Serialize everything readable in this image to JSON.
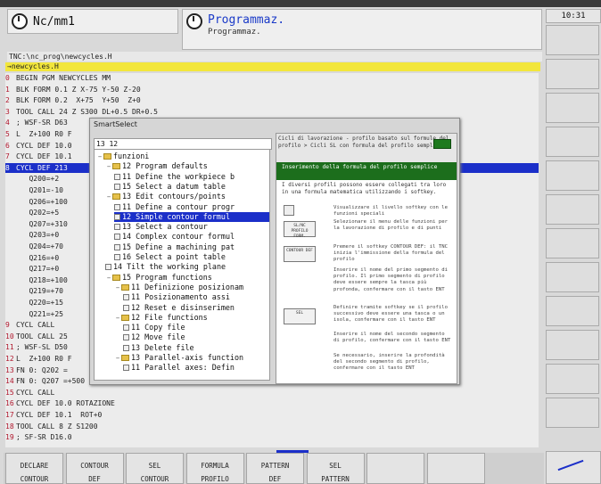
{
  "header": {
    "mode_left": "Nc/mm1",
    "mode_right": "Programmaz.",
    "mode_right_sub": "Programmaz.",
    "clock": "10:31"
  },
  "path": "TNC:\\nc_prog\\newcycles.H",
  "file": "→newcycles.H",
  "program_lines": [
    {
      "n": "0",
      "t": "BEGIN PGM NEWCYCLES MM"
    },
    {
      "n": "1",
      "t": "BLK FORM 0.1 Z X-75 Y-50 Z-20"
    },
    {
      "n": "2",
      "t": "BLK FORM 0.2  X+75  Y+50  Z+0"
    },
    {
      "n": "3",
      "t": "TOOL CALL 24 Z S300 DL+0.5 DR+0.5"
    },
    {
      "n": "4",
      "t": "; WSF-SR D63"
    },
    {
      "n": "5",
      "t": "L  Z+100 R0 F"
    },
    {
      "n": "6",
      "t": "CYCL DEF 10.0"
    },
    {
      "n": "7",
      "t": "CYCL DEF 10.1"
    },
    {
      "n": "8",
      "t": "CYCL DEF 213"
    },
    {
      "n": "",
      "t": "   Q200=+2"
    },
    {
      "n": "",
      "t": "   Q201=-10"
    },
    {
      "n": "",
      "t": "   Q206=+100"
    },
    {
      "n": "",
      "t": "   Q202=+5"
    },
    {
      "n": "",
      "t": "   Q207=+310"
    },
    {
      "n": "",
      "t": "   Q203=+0"
    },
    {
      "n": "",
      "t": "   Q204=+70"
    },
    {
      "n": "",
      "t": "   Q216=+0"
    },
    {
      "n": "",
      "t": "   Q217=+0"
    },
    {
      "n": "",
      "t": "   Q218=+100"
    },
    {
      "n": "",
      "t": "   Q219=+70"
    },
    {
      "n": "",
      "t": "   Q220=+15"
    },
    {
      "n": "",
      "t": "   Q221=+25"
    },
    {
      "n": "9",
      "t": "CYCL CALL"
    },
    {
      "n": "10",
      "t": "TOOL CALL 25"
    },
    {
      "n": "11",
      "t": "; WSF-SL D50"
    },
    {
      "n": "12",
      "t": "L  Z+100 R0 F"
    },
    {
      "n": "13",
      "t": "FN 0: Q202 ="
    },
    {
      "n": "14",
      "t": "FN 0: Q207 =+500"
    },
    {
      "n": "15",
      "t": "CYCL CALL"
    },
    {
      "n": "16",
      "t": "CYCL DEF 10.0 ROTAZIONE"
    },
    {
      "n": "17",
      "t": "CYCL DEF 10.1  ROT+0"
    },
    {
      "n": "18",
      "t": "TOOL CALL 8 Z S1200"
    },
    {
      "n": "19",
      "t": "; SF-SR D16.0"
    }
  ],
  "dialog": {
    "title": "SmartSelect",
    "search": "13 12",
    "tree": [
      {
        "d": 0,
        "k": "folder",
        "t": "funzioni",
        "tw": "−"
      },
      {
        "d": 1,
        "k": "folder",
        "t": "12 Program defaults",
        "tw": "−"
      },
      {
        "d": 2,
        "k": "doc",
        "t": "11 Define the workpiece b"
      },
      {
        "d": 2,
        "k": "doc",
        "t": "15 Select a datum table"
      },
      {
        "d": 1,
        "k": "folder",
        "t": "13 Edit contours/points",
        "tw": "−"
      },
      {
        "d": 2,
        "k": "doc",
        "t": "11 Define a contour progr"
      },
      {
        "d": 2,
        "k": "doc",
        "t": "12 Simple contour formul",
        "sel": true
      },
      {
        "d": 2,
        "k": "doc",
        "t": "13 Select a contour"
      },
      {
        "d": 2,
        "k": "doc",
        "t": "14 Complex contour formul"
      },
      {
        "d": 2,
        "k": "doc",
        "t": "15 Define a machining pat"
      },
      {
        "d": 2,
        "k": "doc",
        "t": "16 Select a point table"
      },
      {
        "d": 1,
        "k": "doc",
        "t": "14 Tilt the working plane"
      },
      {
        "d": 1,
        "k": "folder",
        "t": "15 Program functions",
        "tw": "−"
      },
      {
        "d": 2,
        "k": "folder",
        "t": "11 Definizione posizionam",
        "tw": "−"
      },
      {
        "d": 3,
        "k": "doc",
        "t": "11 Posizionamento assi"
      },
      {
        "d": 3,
        "k": "doc",
        "t": "12 Reset e disinserimen"
      },
      {
        "d": 2,
        "k": "folder",
        "t": "12 File functions",
        "tw": "−"
      },
      {
        "d": 3,
        "k": "doc",
        "t": "11 Copy file"
      },
      {
        "d": 3,
        "k": "doc",
        "t": "12 Move file"
      },
      {
        "d": 3,
        "k": "doc",
        "t": "13 Delete file"
      },
      {
        "d": 2,
        "k": "folder",
        "t": "13 Parallel-axis function",
        "tw": "−"
      },
      {
        "d": 3,
        "k": "doc",
        "t": "11 Parallel axes: Defin"
      }
    ],
    "help": {
      "head": "Cicli di lavorazione - profilo basato sul formule del profilo > Cicli SL con formula del profilo semplice",
      "heading": "Inserimento della formula del profilo semplice",
      "intro": "I diversi profili possono essere collegati tra loro in una formula matematica utilizzando i softkey.",
      "btn1": "SL/NC PROFILO FORM.",
      "btn2": "CONTOUR DEF",
      "btn3": "SEL",
      "steps": [
        "Visualizzare il livello softkey con le funzioni speciali",
        "Selezionare il menu delle funzioni per la lavorazione di profilo e di punti",
        "Premere il softkey CONTOUR DEF: il TNC inizia l'immissione della formula del profilo",
        "Inserire il nome del primo segmento di profilo. Il primo segmento di profilo deve essere sempre la tasca più profonda, confermare con il tasto ENT",
        "Definire tramite softkey se il profilo successivo deve essere una tasca o un isola, confermare con il tasto ENT",
        "Inserire il nome del secondo segmento di profilo, confermare con il tasto ENT",
        "Se necessario, inserire la profondità del secondo segmento di profilo, confermare con il tasto ENT"
      ]
    }
  },
  "softkeys": [
    {
      "l1": "DECLARE",
      "l2": "CONTOUR"
    },
    {
      "l1": "CONTOUR",
      "l2": "DEF"
    },
    {
      "l1": "SEL",
      "l2": "CONTOUR"
    },
    {
      "l1": "FORMULA",
      "l2": "PROFILO"
    },
    {
      "l1": "PATTERN",
      "l2": "DEF"
    },
    {
      "l1": "SEL",
      "l2": "PATTERN"
    },
    {
      "l1": "",
      "l2": ""
    },
    {
      "l1": "",
      "l2": ""
    }
  ]
}
